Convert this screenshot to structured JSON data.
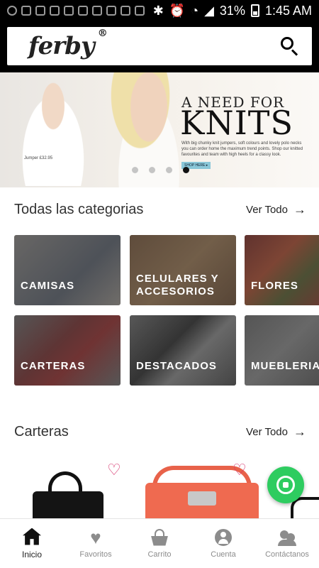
{
  "status_bar": {
    "battery": "31%",
    "time": "1:45 AM"
  },
  "header": {
    "logo": "ferby",
    "logo_mark": "®"
  },
  "hero": {
    "jumper_caption": "Jumper £32.95",
    "headline_small": "A NEED FOR",
    "headline_big": "KNITS",
    "body": "With big chunky knit jumpers, soft colours and lovely polo necks you can order home the maximum trend points. Shop our knitted favourites and team with high heels for a classy look.",
    "shop_button": "SHOP HERE ▸",
    "active_dot": 4
  },
  "categories_section": {
    "title": "Todas las categorias",
    "ver_todo": "Ver Todo",
    "tiles": [
      {
        "label": "CAMISAS"
      },
      {
        "label": "CELULARES Y ACCESORIOS"
      },
      {
        "label": "FLORES"
      },
      {
        "label": "CARTERAS"
      },
      {
        "label": "DESTACADOS"
      },
      {
        "label": "MUEBLERIA"
      }
    ]
  },
  "carteras_section": {
    "title": "Carteras",
    "ver_todo": "Ver Todo"
  },
  "bottom_nav": {
    "items": [
      {
        "label": "Inicio",
        "icon": "home-icon",
        "active": true
      },
      {
        "label": "Favoritos",
        "icon": "heart-icon"
      },
      {
        "label": "Carrito",
        "icon": "cart-icon"
      },
      {
        "label": "Cuenta",
        "icon": "user-icon"
      },
      {
        "label": "Contáctanos",
        "icon": "contact-icon"
      }
    ]
  },
  "colors": {
    "accent_heart": "#d6336c",
    "whatsapp": "#2ecc60",
    "header_bg": "#000000"
  }
}
